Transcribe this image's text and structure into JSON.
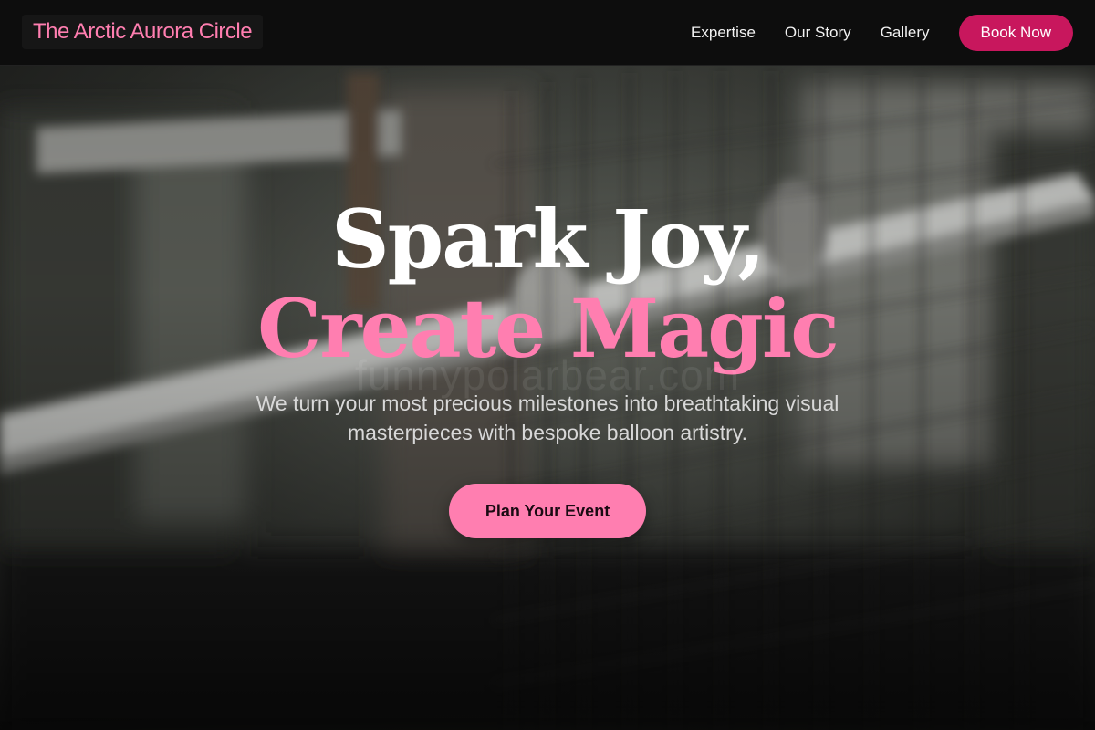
{
  "nav": {
    "brand": "The Arctic Aurora Circle",
    "links": [
      {
        "label": "Expertise"
      },
      {
        "label": "Our Story"
      },
      {
        "label": "Gallery"
      }
    ],
    "book_label": "Book Now"
  },
  "hero": {
    "headline_line1": "Spark Joy,",
    "headline_line2": "Create Magic",
    "watermark": "funnypolarbear.com",
    "subtitle": "We turn your most precious milestones into breathtaking visual masterpieces with bespoke balloon artistry.",
    "cta_label": "Plan Your Event",
    "background_image": "blurred-wire-fence-photo"
  },
  "colors": {
    "accent_pink": "#ff7eb0",
    "book_button": "#c8175d",
    "nav_background": "#0d0d0d",
    "text_white": "#ffffff",
    "subtitle_gray": "#d8d8d8"
  }
}
